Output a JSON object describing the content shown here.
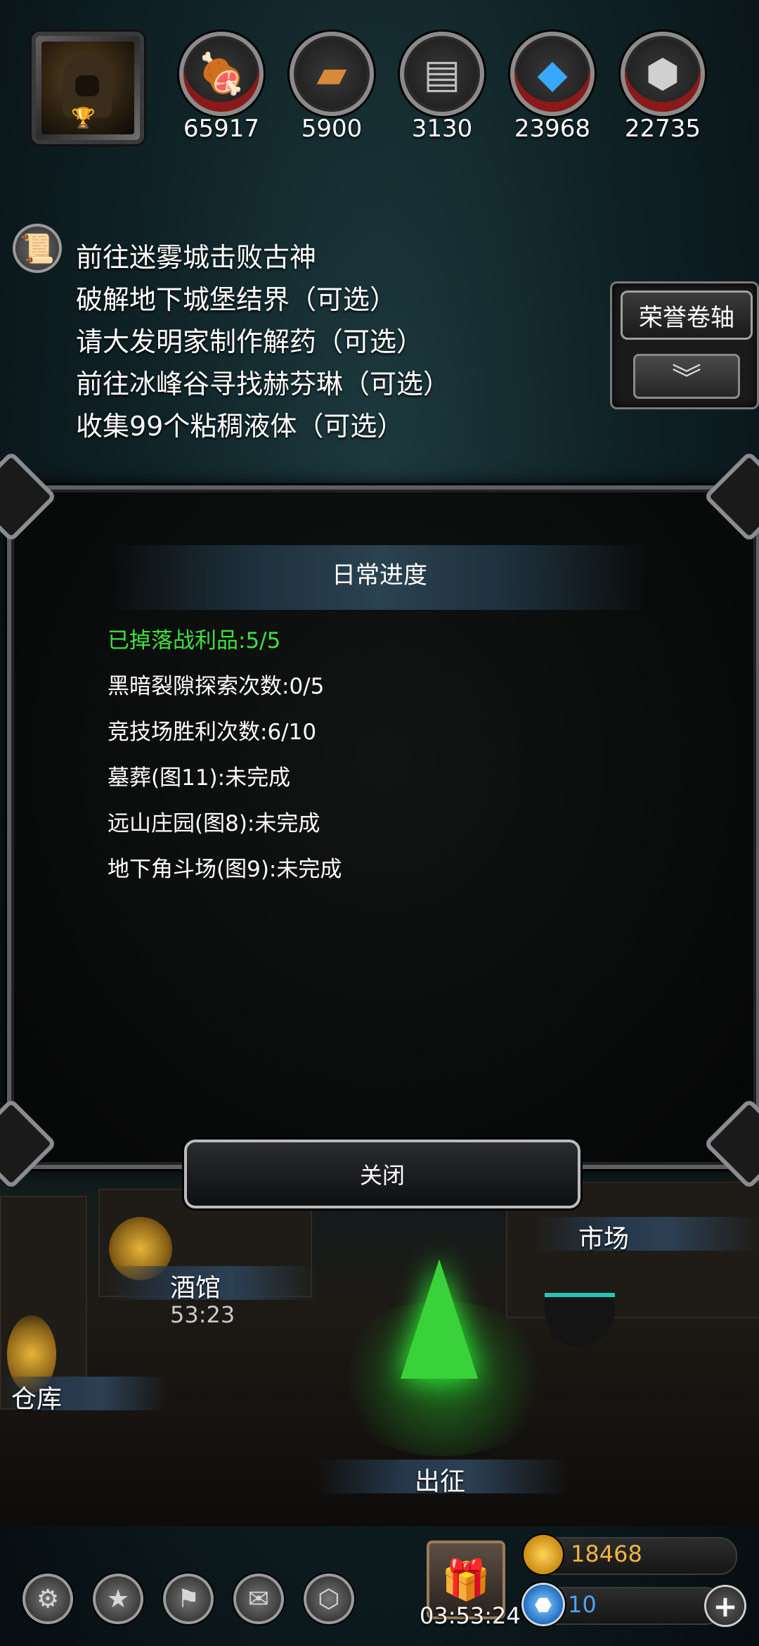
{
  "resources": [
    {
      "icon": "meat-icon",
      "value": "65917"
    },
    {
      "icon": "wood-icon",
      "value": "5900"
    },
    {
      "icon": "iron-icon",
      "value": "3130"
    },
    {
      "icon": "crystal-icon",
      "value": "23968"
    },
    {
      "icon": "ore-icon",
      "value": "22735"
    }
  ],
  "quests": [
    "前往迷雾城击败古神",
    "破解地下城堡结界（可选）",
    "请大发明家制作解药（可选）",
    "前往冰峰谷寻找赫芬琳（可选）",
    "收集99个粘稠液体（可选）"
  ],
  "honor_scroll": {
    "label": "荣誉卷轴"
  },
  "daily_progress": {
    "title": "日常进度",
    "lines": [
      "已掉落战利品:5/5",
      "黑暗裂隙探索次数:0/5",
      "竞技场胜利次数:6/10",
      "墓葬(图11):未完成",
      "远山庄园(图8):未完成",
      "地下角斗场(图9):未完成"
    ],
    "close_label": "关闭"
  },
  "town": {
    "market": "市场",
    "tavern": "酒馆",
    "tavern_timer": "53:23",
    "warehouse": "仓库",
    "expedition": "出征"
  },
  "bottom": {
    "gift_timer": "03:53:24",
    "gold": "18468",
    "gems": "10"
  },
  "colors": {
    "completed_text": "#3fe03a",
    "gold_text": "#f2b43b",
    "gem_text": "#4aa3ff"
  }
}
